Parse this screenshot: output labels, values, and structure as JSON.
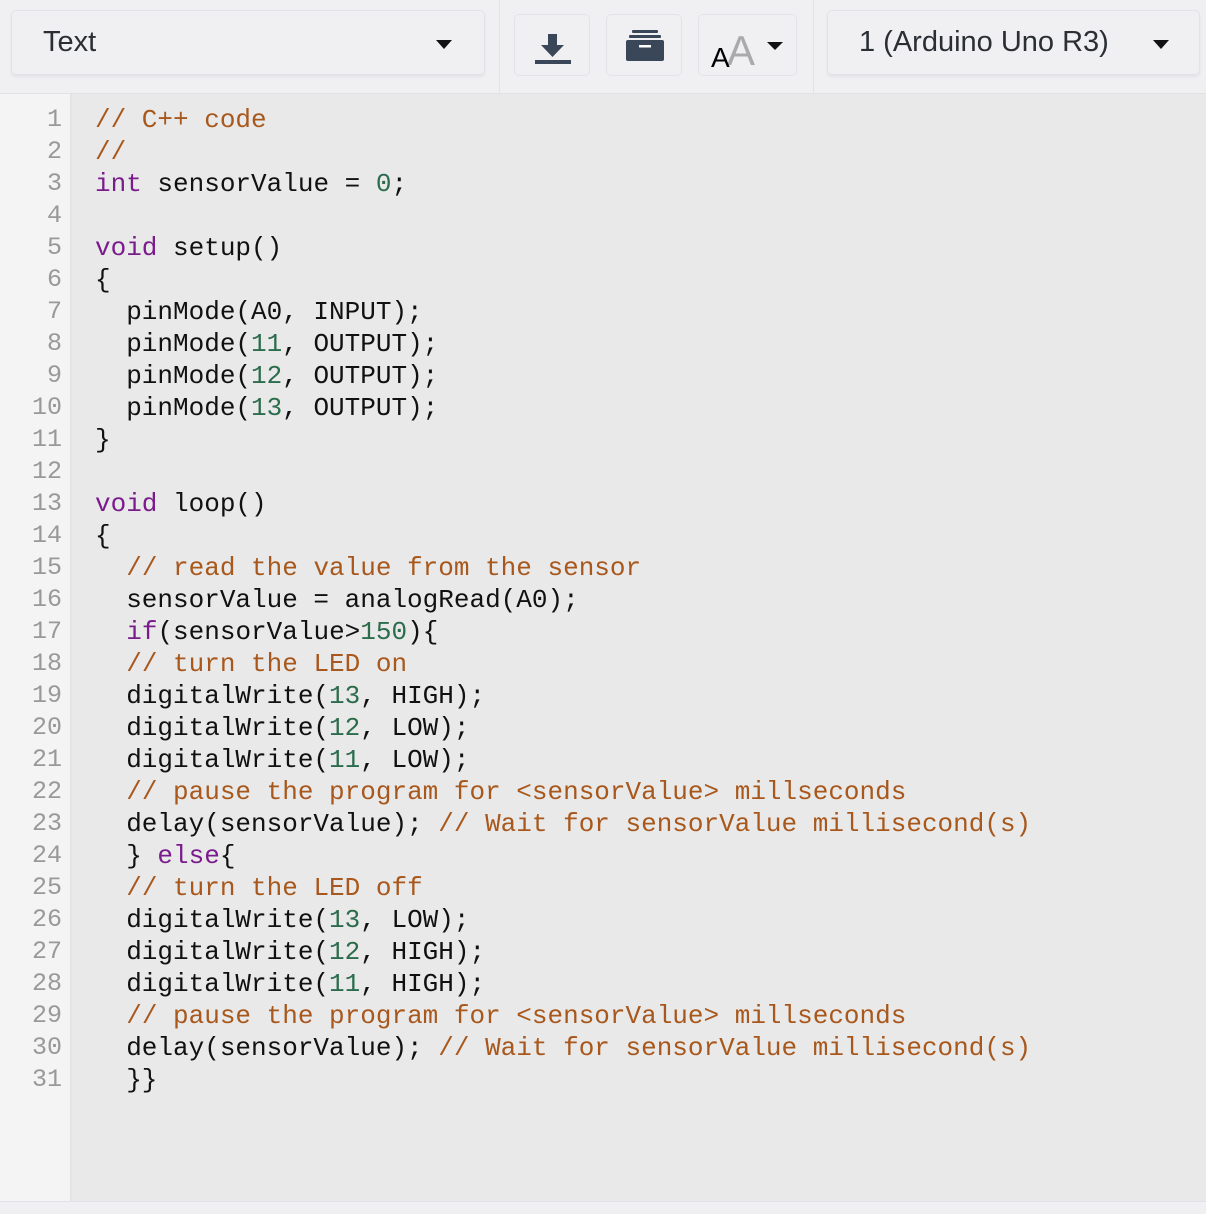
{
  "toolbar": {
    "mode_select": {
      "value": "Text"
    },
    "download_button": {
      "icon": "download-icon"
    },
    "library_button": {
      "icon": "archive-box-icon"
    },
    "font_size_button": {
      "icon": "font-size-icon"
    },
    "board_select": {
      "value": "1 (Arduino Uno R3)"
    }
  },
  "colors": {
    "comment": "#a8581c",
    "keyword": "#7a1c8c",
    "number": "#2b6c4c",
    "text": "#111111",
    "line_number": "#999999",
    "editor_bg": "#e9e9e9"
  },
  "editor": {
    "lines": [
      {
        "n": "1",
        "tokens": [
          {
            "t": "c",
            "v": "// C++ code"
          }
        ]
      },
      {
        "n": "2",
        "tokens": [
          {
            "t": "c",
            "v": "//"
          }
        ]
      },
      {
        "n": "3",
        "tokens": [
          {
            "t": "k",
            "v": "int"
          },
          {
            "t": "p",
            "v": " sensorValue = "
          },
          {
            "t": "n",
            "v": "0"
          },
          {
            "t": "p",
            "v": ";"
          }
        ]
      },
      {
        "n": "4",
        "tokens": []
      },
      {
        "n": "5",
        "tokens": [
          {
            "t": "k",
            "v": "void"
          },
          {
            "t": "p",
            "v": " setup()"
          }
        ]
      },
      {
        "n": "6",
        "tokens": [
          {
            "t": "p",
            "v": "{"
          }
        ]
      },
      {
        "n": "7",
        "tokens": [
          {
            "t": "p",
            "v": "  pinMode(A0, INPUT);"
          }
        ]
      },
      {
        "n": "8",
        "tokens": [
          {
            "t": "p",
            "v": "  pinMode("
          },
          {
            "t": "n",
            "v": "11"
          },
          {
            "t": "p",
            "v": ", OUTPUT);"
          }
        ]
      },
      {
        "n": "9",
        "tokens": [
          {
            "t": "p",
            "v": "  pinMode("
          },
          {
            "t": "n",
            "v": "12"
          },
          {
            "t": "p",
            "v": ", OUTPUT);"
          }
        ]
      },
      {
        "n": "10",
        "tokens": [
          {
            "t": "p",
            "v": "  pinMode("
          },
          {
            "t": "n",
            "v": "13"
          },
          {
            "t": "p",
            "v": ", OUTPUT);"
          }
        ]
      },
      {
        "n": "11",
        "tokens": [
          {
            "t": "p",
            "v": "}"
          }
        ]
      },
      {
        "n": "12",
        "tokens": []
      },
      {
        "n": "13",
        "tokens": [
          {
            "t": "k",
            "v": "void"
          },
          {
            "t": "p",
            "v": " loop()"
          }
        ]
      },
      {
        "n": "14",
        "tokens": [
          {
            "t": "p",
            "v": "{"
          }
        ]
      },
      {
        "n": "15",
        "tokens": [
          {
            "t": "p",
            "v": "  "
          },
          {
            "t": "c",
            "v": "// read the value from the sensor"
          }
        ]
      },
      {
        "n": "16",
        "tokens": [
          {
            "t": "p",
            "v": "  sensorValue = analogRead(A0);"
          }
        ]
      },
      {
        "n": "17",
        "tokens": [
          {
            "t": "p",
            "v": "  "
          },
          {
            "t": "k",
            "v": "if"
          },
          {
            "t": "p",
            "v": "(sensorValue>"
          },
          {
            "t": "n",
            "v": "150"
          },
          {
            "t": "p",
            "v": "){"
          }
        ]
      },
      {
        "n": "18",
        "tokens": [
          {
            "t": "p",
            "v": "  "
          },
          {
            "t": "c",
            "v": "// turn the LED on"
          }
        ]
      },
      {
        "n": "19",
        "tokens": [
          {
            "t": "p",
            "v": "  digitalWrite("
          },
          {
            "t": "n",
            "v": "13"
          },
          {
            "t": "p",
            "v": ", HIGH);"
          }
        ]
      },
      {
        "n": "20",
        "tokens": [
          {
            "t": "p",
            "v": "  digitalWrite("
          },
          {
            "t": "n",
            "v": "12"
          },
          {
            "t": "p",
            "v": ", LOW);"
          }
        ]
      },
      {
        "n": "21",
        "tokens": [
          {
            "t": "p",
            "v": "  digitalWrite("
          },
          {
            "t": "n",
            "v": "11"
          },
          {
            "t": "p",
            "v": ", LOW);"
          }
        ]
      },
      {
        "n": "22",
        "tokens": [
          {
            "t": "p",
            "v": "  "
          },
          {
            "t": "c",
            "v": "// pause the program for <sensorValue> millseconds"
          }
        ]
      },
      {
        "n": "23",
        "tokens": [
          {
            "t": "p",
            "v": "  delay(sensorValue); "
          },
          {
            "t": "c",
            "v": "// Wait for sensorValue millisecond(s)"
          }
        ]
      },
      {
        "n": "24",
        "tokens": [
          {
            "t": "p",
            "v": "  } "
          },
          {
            "t": "k",
            "v": "else"
          },
          {
            "t": "p",
            "v": "{"
          }
        ]
      },
      {
        "n": "25",
        "tokens": [
          {
            "t": "p",
            "v": "  "
          },
          {
            "t": "c",
            "v": "// turn the LED off"
          }
        ]
      },
      {
        "n": "26",
        "tokens": [
          {
            "t": "p",
            "v": "  digitalWrite("
          },
          {
            "t": "n",
            "v": "13"
          },
          {
            "t": "p",
            "v": ", LOW);"
          }
        ]
      },
      {
        "n": "27",
        "tokens": [
          {
            "t": "p",
            "v": "  digitalWrite("
          },
          {
            "t": "n",
            "v": "12"
          },
          {
            "t": "p",
            "v": ", HIGH);"
          }
        ]
      },
      {
        "n": "28",
        "tokens": [
          {
            "t": "p",
            "v": "  digitalWrite("
          },
          {
            "t": "n",
            "v": "11"
          },
          {
            "t": "p",
            "v": ", HIGH);"
          }
        ]
      },
      {
        "n": "29",
        "tokens": [
          {
            "t": "p",
            "v": "  "
          },
          {
            "t": "c",
            "v": "// pause the program for <sensorValue> millseconds"
          }
        ]
      },
      {
        "n": "30",
        "tokens": [
          {
            "t": "p",
            "v": "  delay(sensorValue); "
          },
          {
            "t": "c",
            "v": "// Wait for sensorValue millisecond(s)"
          }
        ]
      },
      {
        "n": "31",
        "tokens": [
          {
            "t": "p",
            "v": "  }}"
          }
        ]
      }
    ]
  }
}
